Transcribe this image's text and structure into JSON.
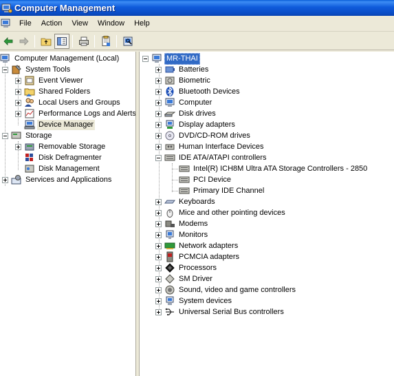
{
  "window": {
    "title": "Computer Management"
  },
  "menu": [
    "File",
    "Action",
    "View",
    "Window",
    "Help"
  ],
  "toolbar": [
    "back-arrow-icon",
    "forward-arrow-icon",
    "up-folder-icon",
    "show-hide-tree-icon",
    "print-icon",
    "properties-icon",
    "help-icon"
  ],
  "left_tree": {
    "root": "Computer Management (Local)",
    "system_tools": {
      "label": "System Tools",
      "items": [
        "Event Viewer",
        "Shared Folders",
        "Local Users and Groups",
        "Performance Logs and Alerts",
        "Device Manager"
      ]
    },
    "storage": {
      "label": "Storage",
      "items": [
        "Removable Storage",
        "Disk Defragmenter",
        "Disk Management"
      ]
    },
    "services": "Services and Applications",
    "selected": "Device Manager"
  },
  "right_tree": {
    "root": "MR-THAI",
    "categories": [
      "Batteries",
      "Biometric",
      "Bluetooth Devices",
      "Computer",
      "Disk drives",
      "Display adapters",
      "DVD/CD-ROM drives",
      "Human Interface Devices",
      "IDE ATA/ATAPI controllers"
    ],
    "ide_children": [
      "Intel(R) ICH8M Ultra ATA Storage Controllers - 2850",
      "PCI Device",
      "Primary IDE Channel"
    ],
    "categories_after": [
      "Keyboards",
      "Mice and other pointing devices",
      "Modems",
      "Monitors",
      "Network adapters",
      "PCMCIA adapters",
      "Processors",
      "SM Driver",
      "Sound, video and game controllers",
      "System devices",
      "Universal Serial Bus controllers"
    ]
  },
  "colors": {
    "title_bar": "#0A4CC4",
    "selection": "#316AC5",
    "chrome": "#ECE9D8"
  }
}
